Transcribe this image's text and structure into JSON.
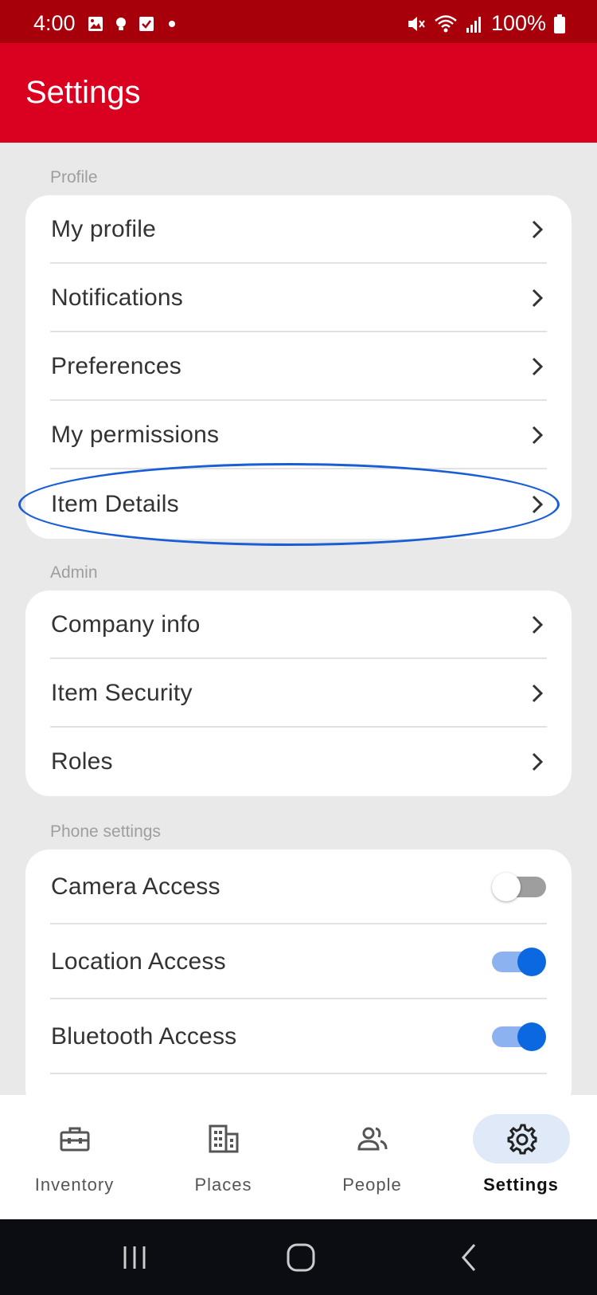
{
  "status_bar": {
    "time": "4:00",
    "battery": "100%",
    "left_icons": [
      "image-icon",
      "bulb-icon",
      "checkbox-icon",
      "dot-icon"
    ],
    "right_icons": [
      "mute-icon",
      "wifi-icon",
      "signal-icon",
      "battery-icon"
    ]
  },
  "app_bar": {
    "title": "Settings"
  },
  "sections": {
    "profile": {
      "label": "Profile",
      "items": [
        {
          "label": "My profile"
        },
        {
          "label": "Notifications"
        },
        {
          "label": "Preferences"
        },
        {
          "label": "My permissions"
        },
        {
          "label": "Item Details",
          "highlighted": true
        }
      ]
    },
    "admin": {
      "label": "Admin",
      "items": [
        {
          "label": "Company info"
        },
        {
          "label": "Item Security"
        },
        {
          "label": "Roles"
        }
      ]
    },
    "phone": {
      "label": "Phone settings",
      "items": [
        {
          "label": "Camera Access",
          "enabled": false
        },
        {
          "label": "Location Access",
          "enabled": true
        },
        {
          "label": "Bluetooth Access",
          "enabled": true
        }
      ]
    }
  },
  "bottom_nav": {
    "items": [
      {
        "label": "Inventory",
        "icon": "toolbox-icon",
        "active": false
      },
      {
        "label": "Places",
        "icon": "building-icon",
        "active": false
      },
      {
        "label": "People",
        "icon": "people-icon",
        "active": false
      },
      {
        "label": "Settings",
        "icon": "gear-icon",
        "active": true
      }
    ]
  },
  "colors": {
    "status_bar": "#a8000b",
    "app_bar": "#da0020",
    "accent": "#0b68e0",
    "highlight": "#1a5ed6",
    "nav_active_bg": "#dfe9f8"
  }
}
